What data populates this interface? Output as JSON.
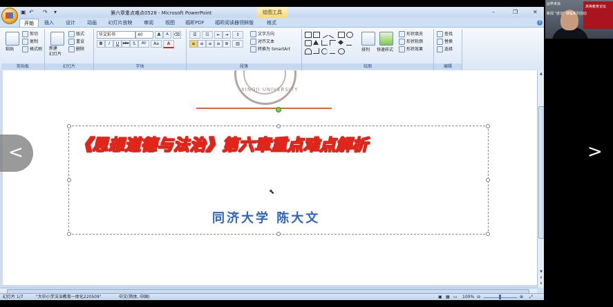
{
  "window": {
    "doc_title": "第六章重点难点0528 - Microsoft PowerPoint",
    "context_tab": "绘图工具",
    "minimize": "–",
    "restore": "❐",
    "close": "✕"
  },
  "tabs": [
    "开始",
    "插入",
    "设计",
    "动画",
    "幻灯片放映",
    "审阅",
    "视图",
    "福昕PDF",
    "福昕阅读器领鲜版",
    "格式"
  ],
  "ribbon": {
    "clipboard": {
      "label": "剪贴板",
      "paste": "粘贴",
      "cut": "剪切",
      "copy": "复制",
      "format_painter": "格式刷"
    },
    "slides": {
      "label": "幻灯片",
      "new_slide": "新建\n幻灯片",
      "layout": "版式",
      "reset": "重设",
      "delete": "删除"
    },
    "font": {
      "label": "字体",
      "font_name": "华文彩书",
      "font_size": "40",
      "bold": "B",
      "italic": "I",
      "underline": "U",
      "strike": "abc",
      "shadow": "S",
      "spacing": "AV",
      "case": "Aa",
      "color": "A",
      "grow": "A",
      "shrink": "A"
    },
    "paragraph": {
      "label": "段落",
      "text_direction": "文字方向",
      "align_text": "对齐文本",
      "smartart": "转换为 SmartArt"
    },
    "drawing": {
      "label": "绘图",
      "arrange": "排列",
      "quick_styles": "快速样式",
      "fill": "形状填充",
      "outline": "形状轮廓",
      "effects": "形状效果"
    },
    "editing": {
      "label": "编辑",
      "find": "查找",
      "replace": "替换",
      "select": "选择"
    }
  },
  "slide": {
    "seal_text": "XINGJI UNIVERSITY",
    "title": "《思想道德与法治》第六章重点难点解析",
    "subtitle": "同济大学  陈大文"
  },
  "status": {
    "slide_num": "幻灯片 1/7",
    "theme": "\"大中小学法治教育一体化220509\"",
    "language": "中文(简体, 中国)",
    "zoom": "100%"
  },
  "webcam": {
    "line1": "@学术派",
    "line2": "高等教育论坛",
    "line3": "新闻 \"道法\" 课程系列活动"
  }
}
